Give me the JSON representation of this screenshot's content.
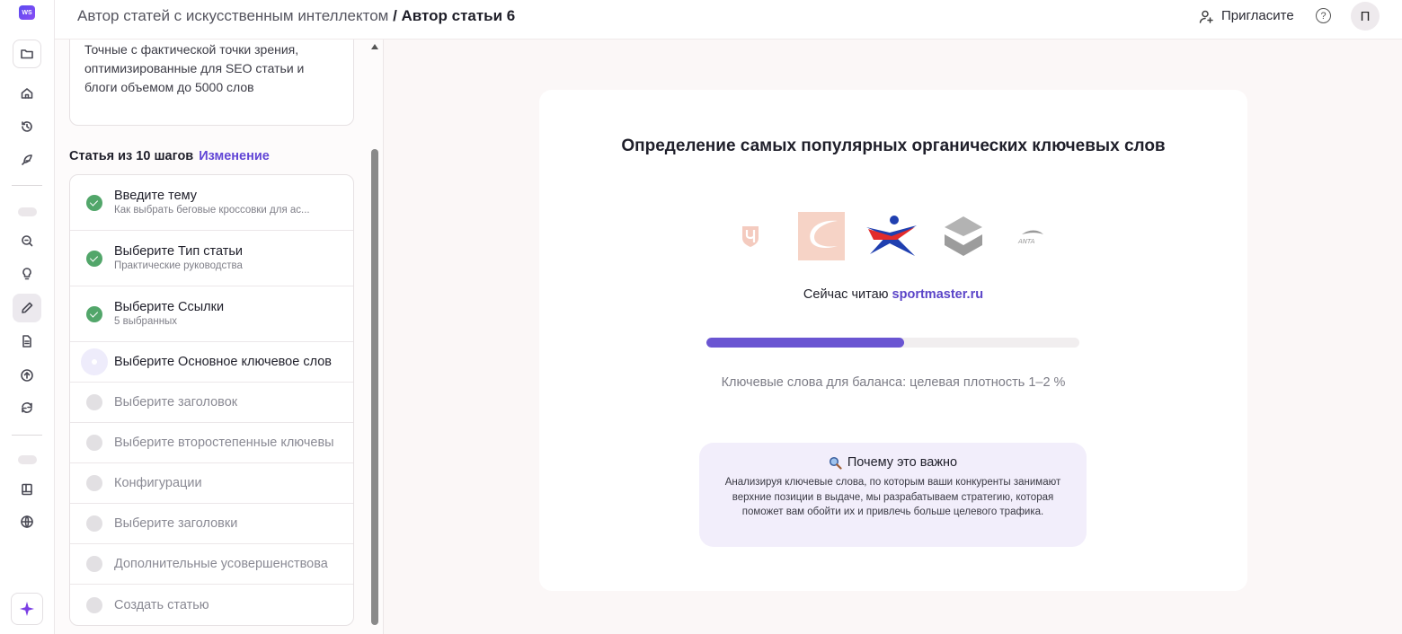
{
  "app": {
    "logo_text": "WS"
  },
  "header": {
    "breadcrumb_parent": "Автор статей с искусственным интеллектом",
    "breadcrumb_separator": " / ",
    "breadcrumb_current": "Автор статьи 6",
    "invite_label": "Пригласите",
    "help_label": "?",
    "avatar_initial": "П"
  },
  "panel": {
    "description_lines": [
      "Точные с фактической точки зрения,",
      "оптимизированные для SEO статьи и",
      "блоги объемом до 5000 слов"
    ],
    "steps_title": "Статья из 10 шагов",
    "change_label": "Изменение",
    "steps": [
      {
        "label": "Введите тему",
        "sub": "Как выбрать беговые кроссовки для ас...",
        "status": "done"
      },
      {
        "label": "Выберите Тип статьи",
        "sub": "Практические руководства",
        "status": "done"
      },
      {
        "label": "Выберите Ссылки",
        "sub": "5 выбранных",
        "status": "done"
      },
      {
        "label": "Выберите Основное ключевое слов",
        "sub": "",
        "status": "current"
      },
      {
        "label": "Выберите заголовок",
        "sub": "",
        "status": "pending"
      },
      {
        "label": "Выберите второстепенные ключевы",
        "sub": "",
        "status": "pending"
      },
      {
        "label": "Конфигурации",
        "sub": "",
        "status": "pending"
      },
      {
        "label": "Выберите заголовки",
        "sub": "",
        "status": "pending"
      },
      {
        "label": "Дополнительные усовершенствова",
        "sub": "",
        "status": "pending"
      },
      {
        "label": "Создать статью",
        "sub": "",
        "status": "pending"
      }
    ]
  },
  "main": {
    "title": "Определение самых популярных органических ключевых слов",
    "reading_prefix": "Сейчас читаю ",
    "reading_site": "sportmaster.ru",
    "progress": 0.53,
    "balance_text": "Ключевые слова для баланса: целевая плотность 1–2 %",
    "why_title": "Почему это важно",
    "why_text": "Анализируя ключевые слова, по которым ваши конкуренты занимают верхние позиции в выдаче, мы разрабатываем стратегию, которая поможет вам обойти их и привлечь больше целевого трафика.",
    "logo_anta_text": "ANTA"
  },
  "colors": {
    "accent": "#6246d6",
    "progress_fill": "#6a55d2",
    "done_green": "#52a66a",
    "why_bg": "#f2eefb"
  }
}
